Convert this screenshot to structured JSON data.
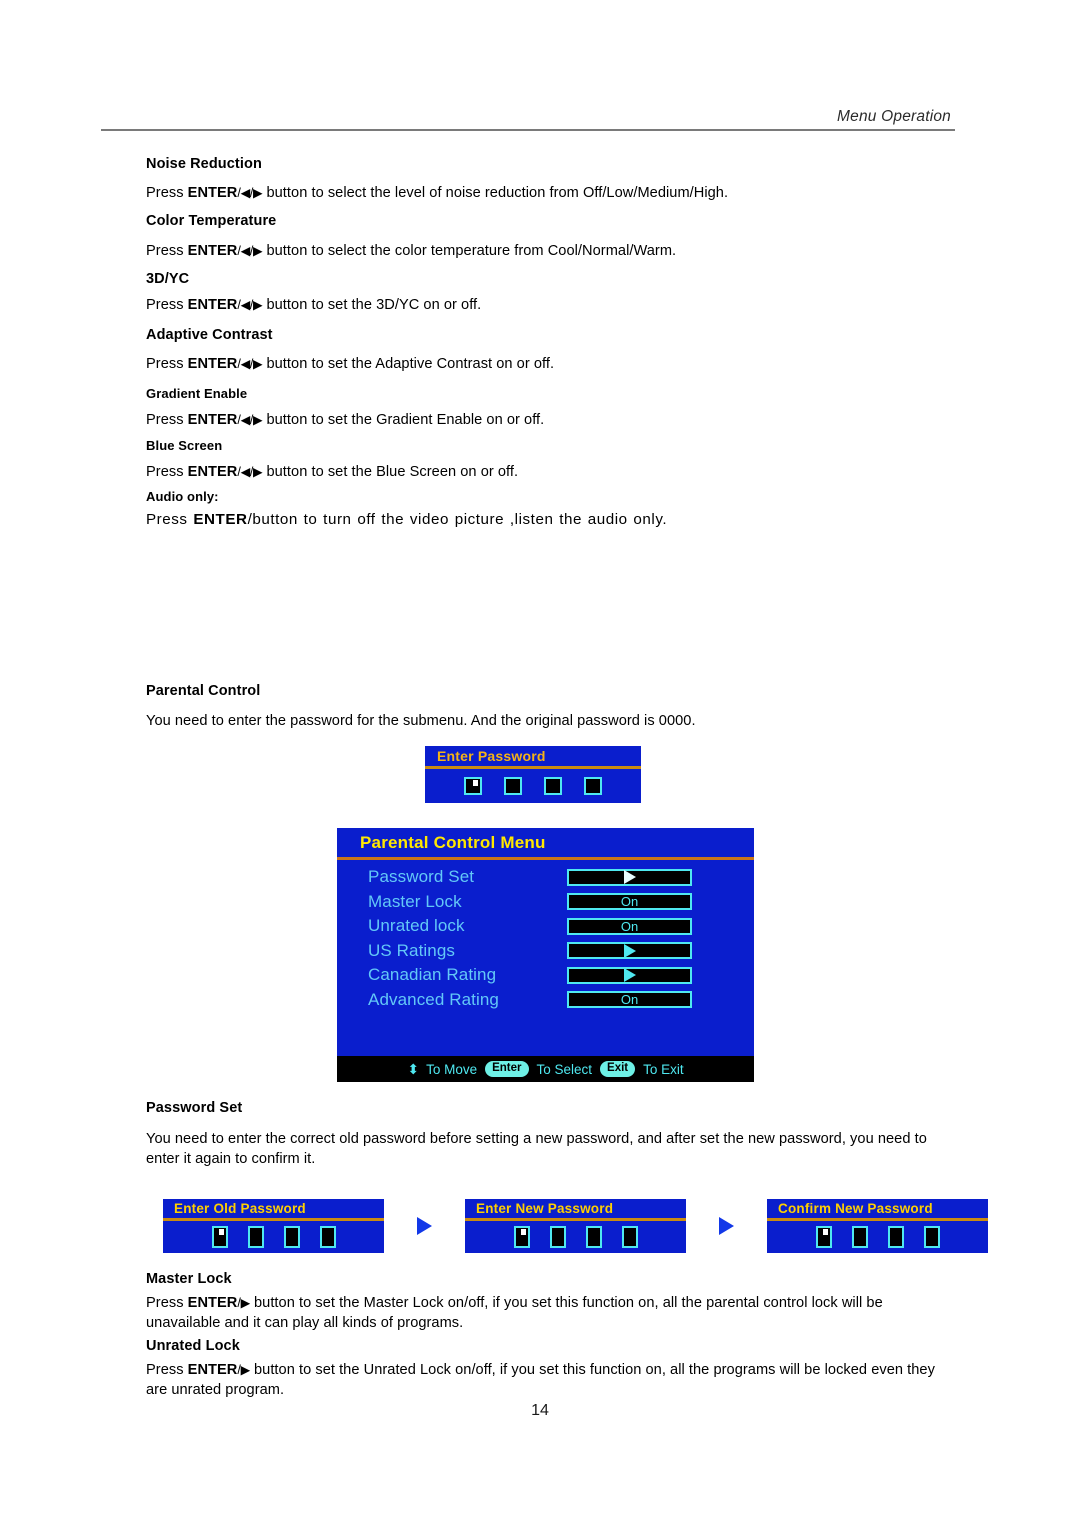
{
  "header": {
    "title": "Menu Operation"
  },
  "sections": [
    {
      "heading": "Noise Reduction",
      "body_prefix": "Press ",
      "body_bold": "ENTER",
      "body_keys": "/◀/▶",
      "body_rest": " button to select the level of noise reduction from Off/Low/Medium/High."
    },
    {
      "heading": "Color Temperature",
      "body_prefix": "Press ",
      "body_bold": "ENTER",
      "body_keys": "/◀/▶",
      "body_rest": " button to select the color temperature from Cool/Normal/Warm."
    },
    {
      "heading": "3D/YC",
      "body_prefix": "Press ",
      "body_bold": "ENTER",
      "body_keys": "/◀/▶",
      "body_rest": " button to set the 3D/YC on or off."
    },
    {
      "heading": "Adaptive Contrast",
      "body_prefix": "Press ",
      "body_bold": "ENTER",
      "body_keys": "/◀/▶",
      "body_rest": " button to set the Adaptive Contrast on or off."
    },
    {
      "heading": "Gradient Enable",
      "body_prefix": "Press ",
      "body_bold": "ENTER",
      "body_keys": "/◀/▶",
      "body_rest": " button to set the Gradient Enable on or off."
    },
    {
      "heading": "Blue Screen",
      "body_prefix": "Press ",
      "body_bold": "ENTER",
      "body_keys": "/◀/▶",
      "body_rest": " button to set the Blue Screen on or off."
    },
    {
      "heading": "Audio only:",
      "body_prefix": "Press ",
      "body_bold": "ENTER",
      "body_keys": "",
      "body_rest": "/button to turn off the video picture ,listen the audio only."
    }
  ],
  "parental": {
    "heading": "Parental Control",
    "description": "You need to enter the password for the submenu. And the original password is 0000.",
    "enter_password_dialog": {
      "title": "Enter Password",
      "box_count": 4
    },
    "menu": {
      "title": "Parental Control Menu",
      "rows": [
        {
          "label": "Password Set",
          "value": "",
          "value_type": "arrow-white"
        },
        {
          "label": "Master Lock",
          "value": "On",
          "value_type": "text"
        },
        {
          "label": "Unrated lock",
          "value": "On",
          "value_type": "text"
        },
        {
          "label": "US Ratings",
          "value": "",
          "value_type": "arrow-cyan"
        },
        {
          "label": "Canadian Rating",
          "value": "",
          "value_type": "arrow-cyan"
        },
        {
          "label": "Advanced Rating",
          "value": "On",
          "value_type": "text"
        }
      ],
      "footer": {
        "move_icon": "⬍",
        "move_label": "To Move",
        "enter_key": "Enter",
        "select_label": "To Select",
        "exit_key": "Exit",
        "exit_label": "To Exit"
      }
    }
  },
  "password_set": {
    "heading": "Password Set",
    "description_line1": "You need to enter the correct old password before setting a new password, and after set the new password, you need to",
    "description_line2": "enter it again to confirm it.",
    "dialogs": [
      {
        "title": "Enter Old Password"
      },
      {
        "title": "Enter New Password"
      },
      {
        "title": "Confirm New Password"
      }
    ]
  },
  "master_lock": {
    "heading": "Master Lock",
    "body_prefix": "Press ",
    "body_bold": "ENTER",
    "body_keys": "/▶",
    "body_line1_rest": " button to set the Master Lock on/off, if you set this function on, all the parental control lock will be",
    "body_line2": "unavailable and it can play all kinds of programs."
  },
  "unrated_lock": {
    "heading": "Unrated Lock",
    "body_prefix": "Press ",
    "body_bold": "ENTER",
    "body_keys": "/▶",
    "body_line1_rest": " button to set the Unrated Lock on/off, if you set this function on, all the programs will be locked even they",
    "body_line2": "are unrated program."
  },
  "page_number": "14",
  "colors": {
    "osd_blue": "#0a1ecd",
    "osd_title_yellow": "#ffe800",
    "osd_title_gold": "#f5b316",
    "osd_divider": "#c9761a",
    "osd_label_cyan": "#63c8f7",
    "osd_value_cyan": "#4fe8f0",
    "osd_pill": "#6ef0e6",
    "flow_arrow_blue": "#1238e8"
  }
}
